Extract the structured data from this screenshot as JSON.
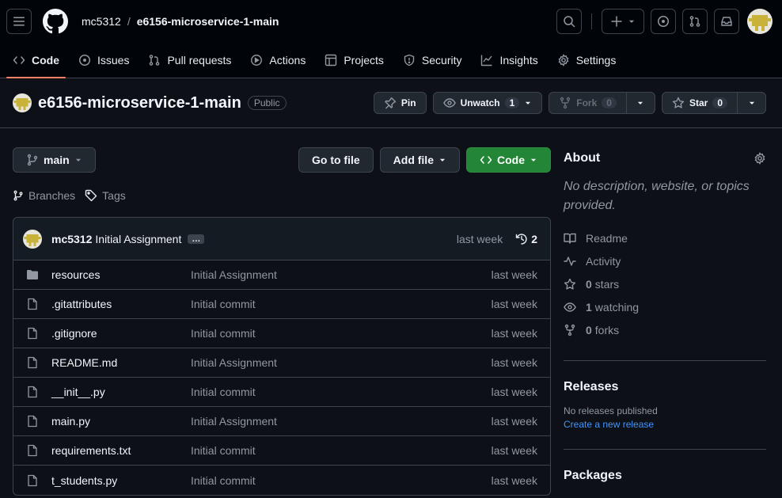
{
  "header": {
    "owner": "mc5312",
    "separator": "/",
    "repo": "e6156-microservice-1-main"
  },
  "tabs": [
    {
      "label": "Code",
      "icon": "code-icon"
    },
    {
      "label": "Issues",
      "icon": "issue-icon"
    },
    {
      "label": "Pull requests",
      "icon": "pull-request-icon"
    },
    {
      "label": "Actions",
      "icon": "play-icon"
    },
    {
      "label": "Projects",
      "icon": "table-icon"
    },
    {
      "label": "Security",
      "icon": "shield-icon"
    },
    {
      "label": "Insights",
      "icon": "graph-icon"
    },
    {
      "label": "Settings",
      "icon": "gear-icon"
    }
  ],
  "repohead": {
    "name": "e6156-microservice-1-main",
    "visibility": "Public",
    "pin_label": "Pin",
    "unwatch_label": "Unwatch",
    "watch_count": "1",
    "fork_label": "Fork",
    "fork_count": "0",
    "star_label": "Star",
    "star_count": "0"
  },
  "toolbar": {
    "branch": "main",
    "goto_file": "Go to file",
    "add_file": "Add file",
    "code": "Code",
    "branches": "Branches",
    "tags": "Tags"
  },
  "commit": {
    "author": "mc5312",
    "message": "Initial Assignment",
    "ellipsis": "…",
    "time": "last week",
    "count": "2"
  },
  "files": [
    {
      "type": "folder",
      "name": "resources",
      "message": "Initial Assignment",
      "time": "last week"
    },
    {
      "type": "file",
      "name": ".gitattributes",
      "message": "Initial commit",
      "time": "last week"
    },
    {
      "type": "file",
      "name": ".gitignore",
      "message": "Initial commit",
      "time": "last week"
    },
    {
      "type": "file",
      "name": "README.md",
      "message": "Initial Assignment",
      "time": "last week"
    },
    {
      "type": "file",
      "name": "__init__.py",
      "message": "Initial commit",
      "time": "last week"
    },
    {
      "type": "file",
      "name": "main.py",
      "message": "Initial Assignment",
      "time": "last week"
    },
    {
      "type": "file",
      "name": "requirements.txt",
      "message": "Initial commit",
      "time": "last week"
    },
    {
      "type": "file",
      "name": "t_students.py",
      "message": "Initial commit",
      "time": "last week"
    }
  ],
  "about": {
    "title": "About",
    "description": "No description, website, or topics provided.",
    "readme": "Readme",
    "activity": "Activity",
    "stars_count": "0",
    "stars_label": "stars",
    "watching_count": "1",
    "watching_label": "watching",
    "forks_count": "0",
    "forks_label": "forks"
  },
  "releases": {
    "title": "Releases",
    "none": "No releases published",
    "create_link": "Create a new release"
  },
  "packages": {
    "title": "Packages"
  },
  "colors": {
    "accent_tab": "#f78166",
    "green_button": "#238636",
    "link": "#4493f8"
  }
}
